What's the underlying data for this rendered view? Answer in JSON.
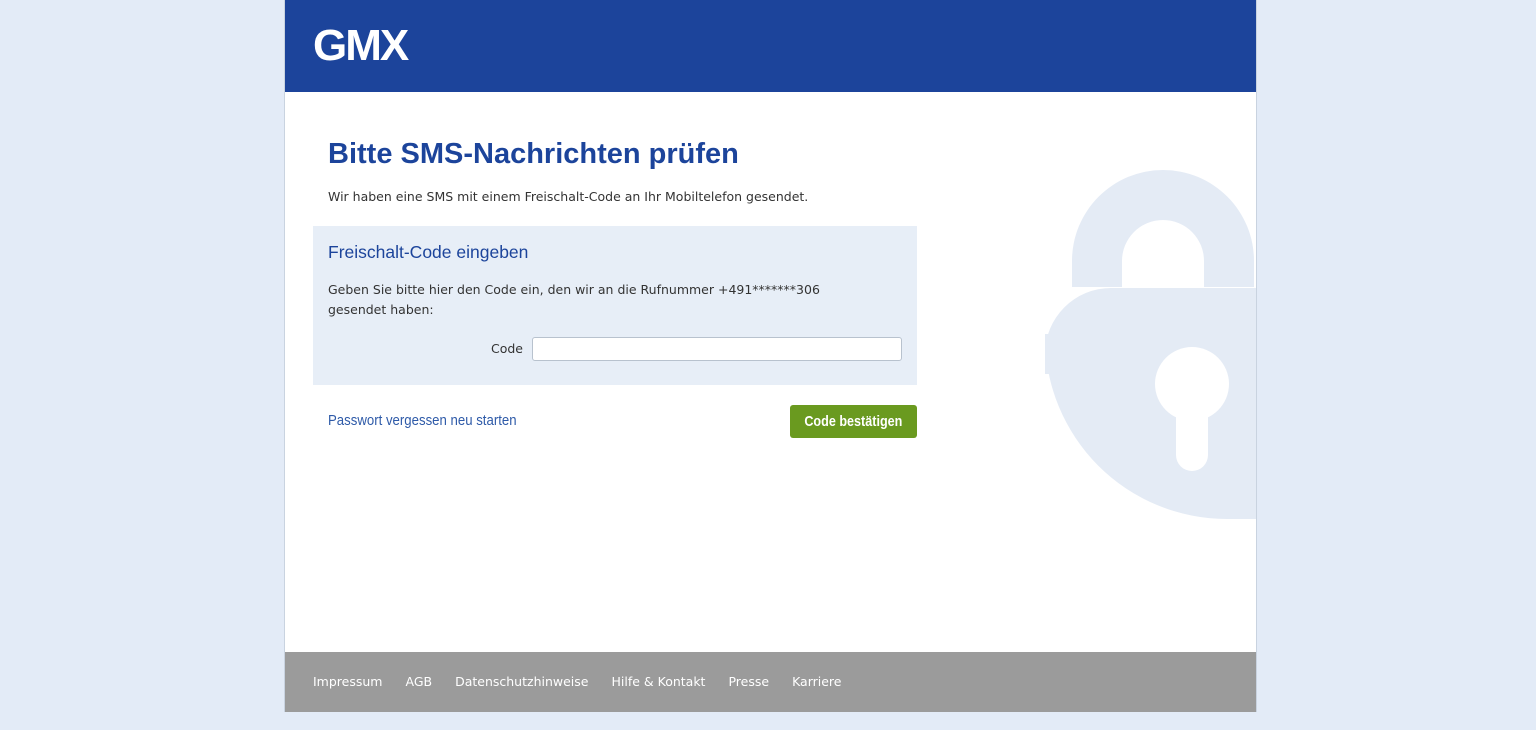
{
  "header": {
    "logo_text": "GMX"
  },
  "main": {
    "title": "Bitte SMS-Nachrichten prüfen",
    "intro": "Wir haben eine SMS mit einem Freischalt-Code an Ihr Mobiltelefon gesendet.",
    "panel": {
      "title": "Freischalt-Code eingeben",
      "text": "Geben Sie bitte hier den Code ein, den wir an die Rufnummer +491*******306 gesendet haben:",
      "code_label": "Code",
      "code_value": ""
    },
    "forgot_link": "Passwort vergessen neu starten",
    "confirm_button": "Code bestätigen"
  },
  "footer": {
    "links": [
      "Impressum",
      "AGB",
      "Datenschutzhinweise",
      "Hilfe & Kontakt",
      "Presse",
      "Karriere"
    ]
  },
  "colors": {
    "brand_blue": "#1c449b",
    "button_green": "#6a9a1f",
    "page_background": "#e3ebf7",
    "panel_background": "#e7eef7",
    "footer_gray": "#9b9b9b"
  },
  "icons": {
    "background_illustration": "padlock-icon"
  }
}
